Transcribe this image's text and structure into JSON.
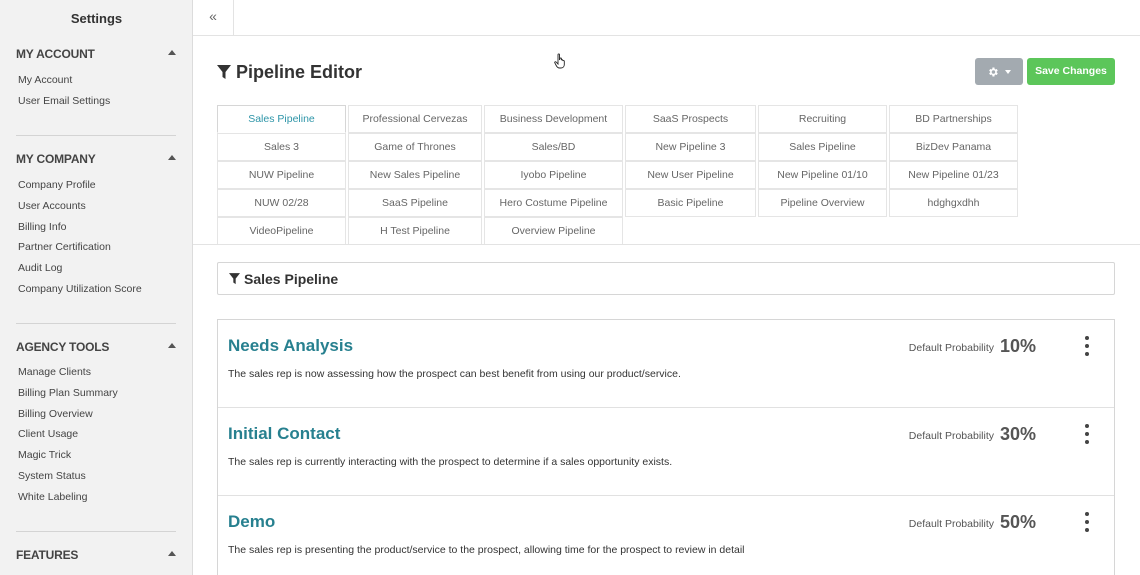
{
  "sidebar": {
    "title": "Settings",
    "sections": [
      {
        "heading": "MY ACCOUNT",
        "items": [
          "My Account",
          "User Email Settings"
        ]
      },
      {
        "heading": "MY COMPANY",
        "items": [
          "Company Profile",
          "User Accounts",
          "Billing Info",
          "Partner Certification",
          "Audit Log",
          "Company Utilization Score"
        ]
      },
      {
        "heading": "AGENCY TOOLS",
        "items": [
          "Manage Clients",
          "Billing Plan Summary",
          "Billing Overview",
          "Client Usage",
          "Magic Trick",
          "System Status",
          "White Labeling"
        ]
      },
      {
        "heading": "FEATURES",
        "items": []
      }
    ]
  },
  "topbar": {
    "collapse_label": "«"
  },
  "header": {
    "title": "Pipeline Editor",
    "save_label": "Save Changes"
  },
  "tabs": [
    "Sales Pipeline",
    "Professional Cervezas",
    "Business Development",
    "SaaS Prospects",
    "Recruiting",
    "BD Partnerships",
    "Sales 3",
    "Game of Thrones",
    "Sales/BD",
    "New Pipeline 3",
    "Sales Pipeline",
    "BizDev Panama",
    "NUW Pipeline",
    "New Sales Pipeline",
    "Iyobo Pipeline",
    "New User Pipeline",
    "New Pipeline 01/10",
    "New Pipeline 01/23",
    "NUW 02/28",
    "SaaS Pipeline",
    "Hero Costume Pipeline",
    "Basic Pipeline",
    "Pipeline Overview",
    "hdghgxdhh",
    "VideoPipeline",
    "H Test Pipeline",
    "Overview Pipeline"
  ],
  "active_tab_index": 0,
  "pipeline": {
    "name": "Sales Pipeline",
    "probability_label": "Default Probability",
    "stages": [
      {
        "name": "Needs Analysis",
        "probability": "10%",
        "description": "The sales rep is now assessing how the prospect can best benefit from using our product/service."
      },
      {
        "name": "Initial Contact",
        "probability": "30%",
        "description": "The sales rep is currently interacting with the prospect to determine if a sales opportunity exists."
      },
      {
        "name": "Demo",
        "probability": "50%",
        "description": "The sales rep is presenting the product/service to the prospect, allowing time for the prospect to review in detail"
      }
    ]
  },
  "colors": {
    "accent": "#2e95a8",
    "stage_title": "#27808f",
    "save_button": "#5cc65a",
    "gear_button": "#a3aab0"
  }
}
